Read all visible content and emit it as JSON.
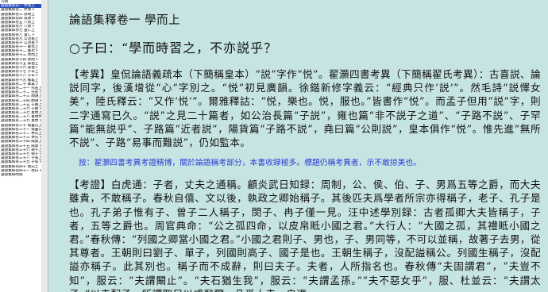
{
  "toc": {
    "items": [
      {
        "label": "凡例",
        "selected": false,
        "indent": false
      },
      {
        "label": "論語集釋卷一 學而上",
        "selected": true,
        "indent": false
      },
      {
        "label": "論語集釋卷二 學而下",
        "selected": false,
        "indent": false
      },
      {
        "label": "論語集釋卷三 爲政上",
        "selected": false,
        "indent": false
      },
      {
        "label": "論語集釋卷四 爲政下",
        "selected": false,
        "indent": false
      },
      {
        "label": "論語集釋卷五 八佾上",
        "selected": false,
        "indent": false
      },
      {
        "label": "論語集釋卷六 八佾下",
        "selected": false,
        "indent": false
      },
      {
        "label": "論語集釋卷七 里仁上",
        "selected": false,
        "indent": false
      },
      {
        "label": "論語集釋卷八 里仁下",
        "selected": false,
        "indent": false
      },
      {
        "label": "論語集釋卷九 公冶長上",
        "selected": false,
        "indent": false
      },
      {
        "label": "論語集釋卷十 公冶長下",
        "selected": false,
        "indent": false
      },
      {
        "label": "論語集釋卷十一 雍也上",
        "selected": false,
        "indent": false
      },
      {
        "label": "論語集釋卷十二 雍也下",
        "selected": false,
        "indent": false
      },
      {
        "label": "論語集釋卷十三 述而上",
        "selected": false,
        "indent": false
      },
      {
        "label": "論語集釋卷十四 述而下",
        "selected": false,
        "indent": false
      },
      {
        "label": "論語集釋卷十五 泰伯上",
        "selected": false,
        "indent": false
      },
      {
        "label": "論語集釋卷十六 泰伯下",
        "selected": false,
        "indent": false
      },
      {
        "label": "論語集釋卷十七 子罕上",
        "selected": false,
        "indent": false
      },
      {
        "label": "論語集釋卷十八 子罕下",
        "selected": false,
        "indent": false
      },
      {
        "label": "論語集釋卷十九 鄉黨上",
        "selected": false,
        "indent": false
      },
      {
        "label": "論語集釋卷二十 鄉黨下",
        "selected": false,
        "indent": false
      },
      {
        "label": "論語集釋卷二十一 先進上",
        "selected": false,
        "indent": false
      },
      {
        "label": "論語集釋卷二十二 先進下",
        "selected": false,
        "indent": false
      },
      {
        "label": "論語集釋卷二十三 顏淵上",
        "selected": false,
        "indent": false
      },
      {
        "label": "論語集釋卷二十四 顏淵下",
        "selected": false,
        "indent": false
      },
      {
        "label": "論語集釋卷二十五 子路上",
        "selected": false,
        "indent": false
      },
      {
        "label": "論語集釋卷二十六 子路下",
        "selected": false,
        "indent": false
      },
      {
        "label": "論語集釋卷二十七 憲問上",
        "selected": false,
        "indent": false
      },
      {
        "label": "論語集釋卷二十八 憲問中",
        "selected": false,
        "indent": false
      },
      {
        "label": "論語集釋卷二十九 憲問下",
        "selected": false,
        "indent": false
      },
      {
        "label": "論語集釋卷三十 衛靈公上",
        "selected": false,
        "indent": false
      },
      {
        "label": "論語集釋卷三十一 衛靈公下",
        "selected": false,
        "indent": false
      },
      {
        "label": "論語集釋卷三十二 季氏上",
        "selected": false,
        "indent": false
      },
      {
        "label": "論語集釋卷三十三 季氏下",
        "selected": false,
        "indent": false
      },
      {
        "label": "論語集釋卷三十四 陽貨上",
        "selected": false,
        "indent": false
      },
      {
        "label": "論語集釋卷三十五 陽貨下",
        "selected": false,
        "indent": false
      },
      {
        "label": "論語集釋卷三十六 微子上",
        "selected": false,
        "indent": false
      },
      {
        "label": "論語集釋卷三十七 微子下",
        "selected": false,
        "indent": false
      },
      {
        "label": "論語集釋卷三十八 子張上",
        "selected": false,
        "indent": false
      },
      {
        "label": "論語集釋卷三十九 子張下",
        "selected": false,
        "indent": false
      },
      {
        "label": "論語集釋卷四十 堯曰上",
        "selected": false,
        "indent": false
      },
      {
        "label": "論語集釋卷四十一 堯曰下",
        "selected": false,
        "indent": false
      },
      {
        "label": "論語集釋附錄",
        "selected": false,
        "indent": false
      }
    ]
  },
  "main": {
    "title": "論語集釋卷一 學而上",
    "quote": "○子曰：“學而時習之，不亦説乎？",
    "kaoyi": "【考異】皇侃論語義疏本（下簡稱皇本）“説”字作“悦”。翟灝四書考異（下簡稱翟氏考異）：古喜説、論説同字，後漢增從“心”字別之。“悦”初見廣韻。徐鍇新修字義云：“經典只作‘説’”。然毛詩“説懌女美”，陸氏釋云：“又作‘悦’”。爾雅釋詁：“悦，樂也。悦，服也。”皆書作“悦”。而孟子但用“説”字，則二字通寫已久。“説”之見二十篇者，如公治長篇“子説”，雍也篇“非不説子之道”、“子路不説”、子罕篇“能無説乎”、子路篇“近者説”，陽貨篇“子路不説”，堯曰篇“公則説”，皇本俱作“悦”。惟先進“無所不説”、子路“易事而難説”，仍如監本。",
    "note": "按：翟灝四書考異考證精博，關於論語稱考部分，本書收録極多。標題仍稱考異者，示不敢掠美也。",
    "kaozheng": "【考證】白虎通：子者，丈夫之通稱。顧炎武日知録：周制，公、侯、伯、子、男爲五等之爵，而大夫雖貴，不敢稱子。春秋自僖、文以後，執政之卿始稱子。其後匹夫爲學者所宗亦得稱子，老子、孔子是也。孔子弟子惟有子、曾子二人稱子，閔子、冉子僅一見。汪中述學別録：古者孤卿大夫皆稱子，子者，五等之爵也。周官典命：“公之孤四命，以皮帛眡小國之君。”大行人：“大國之孤，其禮眡小國之君。”春秋傳：“列國之卿當小國之君。”小國之君則子、男也，子、男同等，不可以並稱，故著子去男，從其尊者。王朝則曰劉子、單子，列國則高子、國子是也。王朝生稱子，沒配謚稱公。列國生稱子，沒配謚亦稱子。此其別也。稱子而不成辭，則曰夫子。夫者，人所指名也。春秋傳“夫固謂君”，“夫豈不知”，服云：“夫謂闞止”。“夫石猶生我”，服云：“夫謂孟孫。”“夫不惡女乎”，服、杜並云：“夫謂太子。”以夫配子，所謂取足以成辭爾。凡爲大夫，自適"
  }
}
